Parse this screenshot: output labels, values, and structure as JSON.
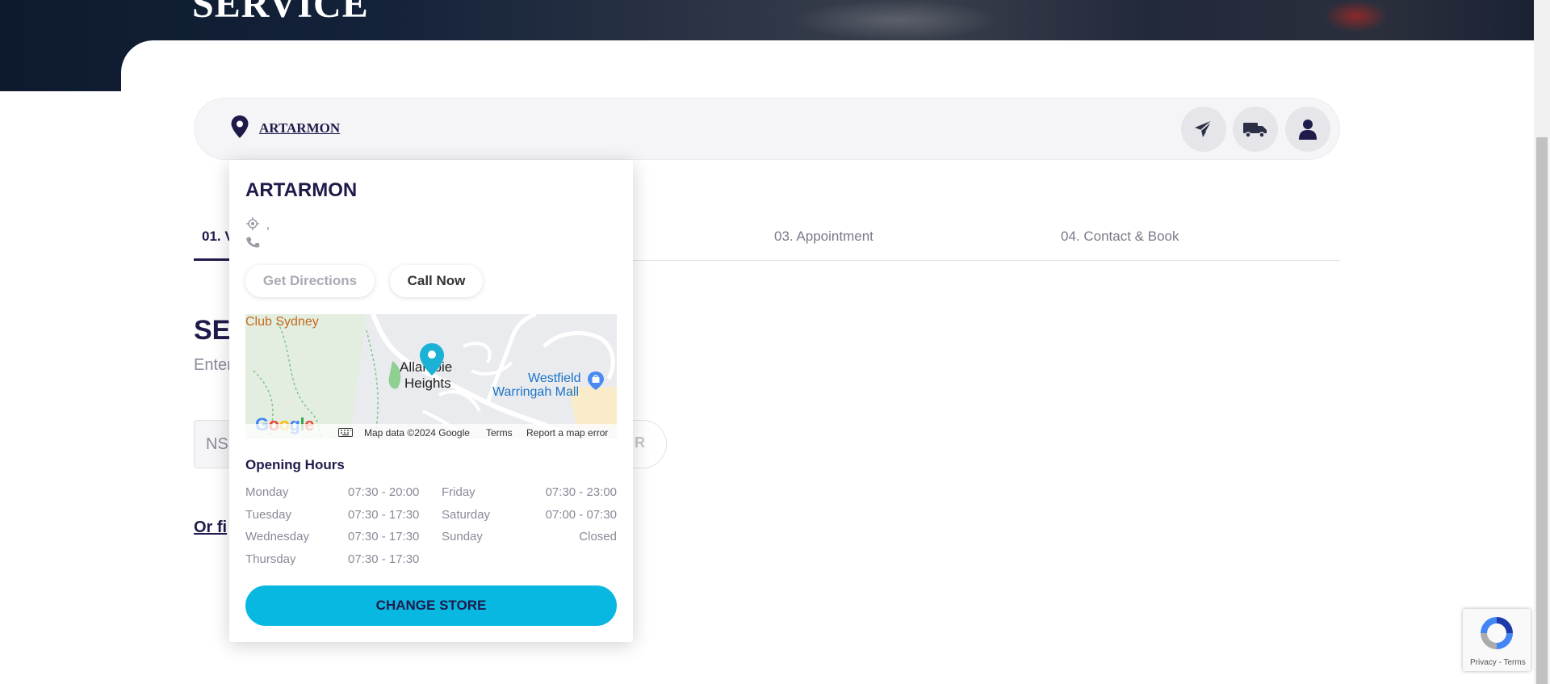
{
  "hero": {
    "title": "SERVICE"
  },
  "store_bar": {
    "store_name": "ARTARMON"
  },
  "steps": [
    {
      "label": "01. V"
    },
    {
      "label": "03. Appointment"
    },
    {
      "label": "04. Contact & Book"
    }
  ],
  "section": {
    "title": "SE",
    "subtitle": "Enter",
    "rego_placeholder": "NS",
    "rego_button_label": "R",
    "find_link": "Or fi"
  },
  "popup": {
    "store_title": "ARTARMON",
    "address": ",",
    "phone": "",
    "directions_label": "Get Directions",
    "call_label": "Call Now",
    "map": {
      "labels": {
        "club": "Club Sydney",
        "suburb_line1": "Allambie",
        "suburb_line2": "Heights",
        "mall_line1": "Westfield",
        "mall_line2": "Warringah Mall"
      },
      "logo": "Google",
      "footer": {
        "data": "Map data ©2024 Google",
        "terms": "Terms",
        "report": "Report a map error"
      }
    },
    "hours_title": "Opening Hours",
    "hours_left": [
      {
        "day": "Monday",
        "time": "07:30 - 20:00"
      },
      {
        "day": "Tuesday",
        "time": "07:30 - 17:30"
      },
      {
        "day": "Wednesday",
        "time": "07:30 - 17:30"
      },
      {
        "day": "Thursday",
        "time": "07:30 - 17:30"
      }
    ],
    "hours_right": [
      {
        "day": "Friday",
        "time": "07:30 - 23:00"
      },
      {
        "day": "Saturday",
        "time": "07:00 - 07:30"
      },
      {
        "day": "Sunday",
        "time": "Closed"
      }
    ],
    "change_store_label": "CHANGE STORE"
  },
  "recaptcha": {
    "footer": "Privacy - Terms"
  },
  "colors": {
    "primary": "#1e1b4b",
    "accent": "#08b8e0",
    "map_pin": "#1cb2d6"
  },
  "icons": [
    "map-pin-icon",
    "paper-plane-icon",
    "truck-icon",
    "user-icon",
    "location-target-icon",
    "phone-icon",
    "keyboard-icon",
    "shopping-bag-icon",
    "recaptcha-icon"
  ]
}
